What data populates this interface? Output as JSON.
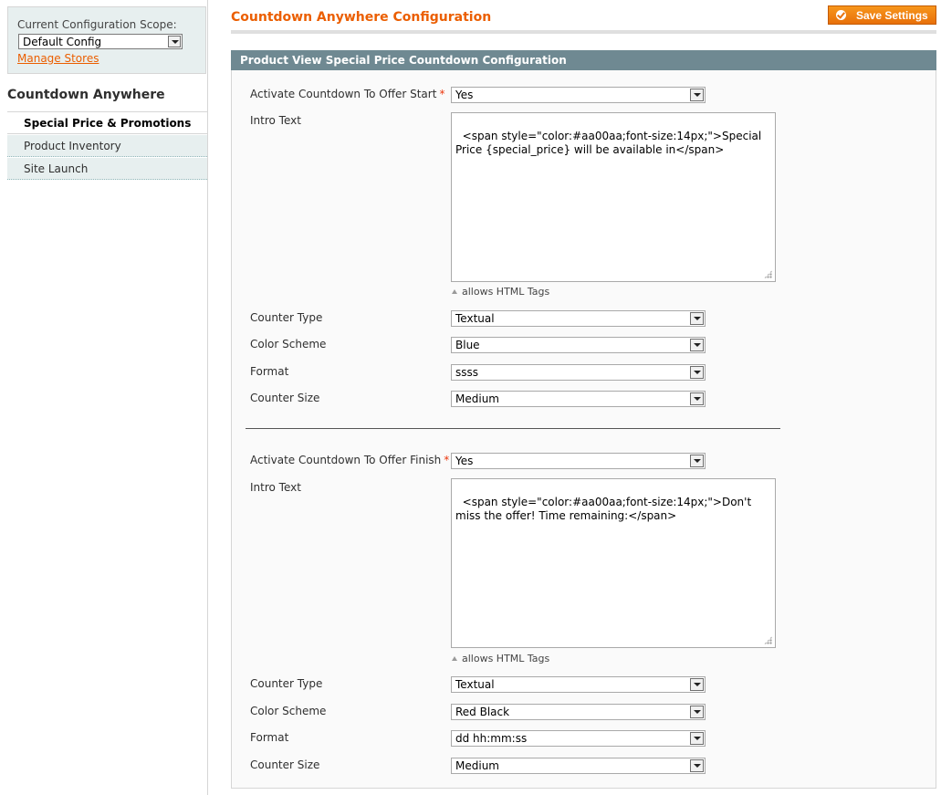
{
  "sidebar": {
    "scope_label": "Current Configuration Scope:",
    "scope_value": "Default Config",
    "manage_stores": "Manage Stores",
    "title": "Countdown Anywhere",
    "items": [
      {
        "label": "Special Price & Promotions",
        "active": true
      },
      {
        "label": "Product Inventory",
        "active": false
      },
      {
        "label": "Site Launch",
        "active": false
      }
    ]
  },
  "header": {
    "title": "Countdown Anywhere Configuration",
    "save_label": "Save Settings"
  },
  "section": {
    "title": "Product View Special Price Countdown Configuration",
    "start": {
      "activate_label": "Activate Countdown To Offer Start",
      "activate_required": "*",
      "activate_value": "Yes",
      "intro_label": "Intro Text",
      "intro_value": "<span style=\"color:#aa00aa;font-size:14px;\">Special Price {special_price} will be available in</span>",
      "intro_note": "allows HTML Tags",
      "counter_type_label": "Counter Type",
      "counter_type_value": "Textual",
      "color_scheme_label": "Color Scheme",
      "color_scheme_value": "Blue",
      "format_label": "Format",
      "format_value": "ssss",
      "counter_size_label": "Counter Size",
      "counter_size_value": "Medium"
    },
    "finish": {
      "activate_label": "Activate Countdown To Offer Finish",
      "activate_required": "*",
      "activate_value": "Yes",
      "intro_label": "Intro Text",
      "intro_value": "<span style=\"color:#aa00aa;font-size:14px;\">Don't miss the offer! Time remaining:</span>",
      "intro_note": "allows HTML Tags",
      "counter_type_label": "Counter Type",
      "counter_type_value": "Textual",
      "color_scheme_label": "Color Scheme",
      "color_scheme_value": "Red Black",
      "format_label": "Format",
      "format_value": "dd hh:mm:ss",
      "counter_size_label": "Counter Size",
      "counter_size_value": "Medium"
    }
  },
  "colors": {
    "accent": "#eb5e00",
    "section_header": "#6f8992",
    "sidebar_bg": "#e7efef",
    "required": "#eb340a"
  }
}
